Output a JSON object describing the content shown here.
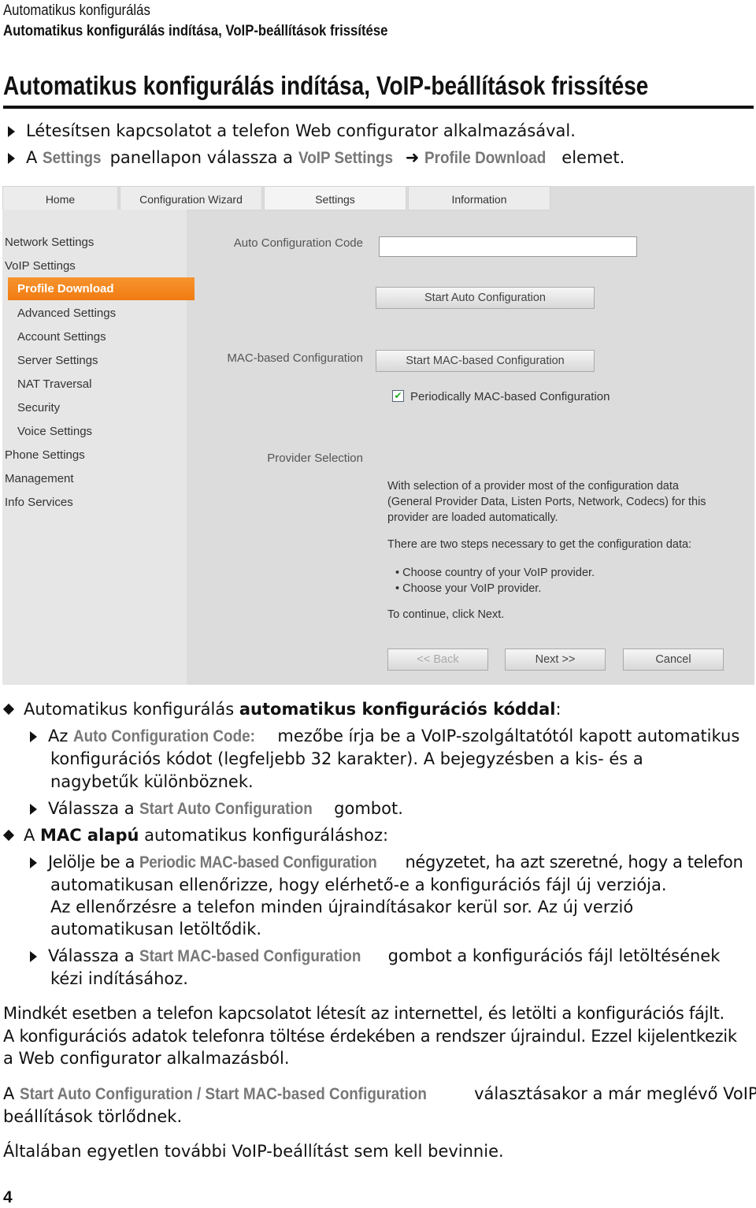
{
  "header": {
    "section": "Automatikus konfigurálás",
    "subsection": "Automatikus konfigurálás indítása, VoIP-beállítások frissítése"
  },
  "title": "Automatikus konfigurálás indítása, VoIP-beállítások frissítése",
  "steps": {
    "s1": "Létesítsen kapcsolatot a telefon Web configurator alkalmazásával.",
    "s2a": "A ",
    "s2b": "Settings",
    "s2c": " panellapon válassza a ",
    "s2d": "VoIP Settings",
    "s2e": "Profile Download",
    "s2f": " elemet."
  },
  "ui": {
    "tabs": [
      "Home",
      "Configuration Wizard",
      "Settings",
      "Information"
    ],
    "sidebar": [
      "Network Settings",
      "VoIP Settings",
      "Profile Download",
      "Advanced Settings",
      "Account Settings",
      "Server Settings",
      "NAT Traversal",
      "Security",
      "Voice Settings",
      "Phone Settings",
      "Management",
      "Info Services"
    ],
    "auto_label": "Auto Configuration Code",
    "auto_value": "",
    "start_auto": "Start Auto Configuration",
    "mac_label": "MAC-based Configuration",
    "start_mac": "Start MAC-based Configuration",
    "periodic": "Periodically MAC-based Configuration",
    "periodic_checked": true,
    "provider_label": "Provider Selection",
    "info1": "With selection of a provider most of the configuration data",
    "info2": "(General Provider Data, Listen Ports, Network, Codecs) for this",
    "info3": "provider are loaded automatically.",
    "info4": "There are two steps necessary to get the configuration data:",
    "bullet1": "Choose country of your VoIP provider.",
    "bullet2": "Choose your VoIP provider.",
    "info5": "To continue, click Next.",
    "back": "<< Back",
    "next": "Next >>",
    "cancel": "Cancel",
    "accent": "#f07b12"
  },
  "body": {
    "a1": "Automatikus konfigurálás ",
    "a1b": "automatikus konfigurációs kóddal",
    ":": ":",
    "b1a": "Az ",
    "b1b": "Auto Configuration Code:",
    "b1c": " mezőbe írja be a VoIP-szolgáltatótól kapott automatikus",
    "b1d": "konfigurációs kódot (legfeljebb 32 karakter). A bejegyzésben a kis- és a",
    "b1e": "nagybetűk különböznek.",
    "b2a": "Válassza a ",
    "b2b": "Start Auto Configuration",
    "b2c": " gombot.",
    "a2a": "A ",
    "a2b": "MAC alapú",
    "a2c": " automatikus konfiguráláshoz:",
    "c1a": "Jelölje be a ",
    "c1b": "Periodic MAC-based Configuration",
    "c1c": " négyzetet, ha azt szeretné, hogy a telefon",
    "c1d": "automatikusan ellenőrizze, hogy elérhető-e a konfigurációs fájl új verziója.",
    "c1e": "Az ellenőrzésre a telefon minden újraindításakor kerül sor. Az új verzió",
    "c1f": "automatikusan letöltődik.",
    "c2a": "Válassza a ",
    "c2b": "Start MAC-based Configuration",
    "c2c": " gombot a konfigurációs fájl letöltésének",
    "c2d": "kézi indításához.",
    "p1": "Mindkét esetben a telefon kapcsolatot létesít az internettel, és letölti a konfigurációs fájlt.",
    "p2": "A konfigurációs adatok telefonra töltése érdekében a rendszer újraindul. Ezzel kijelentkezik",
    "p3": "a Web configurator alkalmazásból.",
    "p4a": "A ",
    "p4b": "Start Auto Configuration / Start MAC-based Configuration",
    "p4c": " választásakor a már meglévő VoIP-",
    "p4d": "beállítások törlődnek.",
    "p5": "Általában egyetlen további VoIP-beállítást sem kell bevinnie."
  },
  "page_number": "4"
}
